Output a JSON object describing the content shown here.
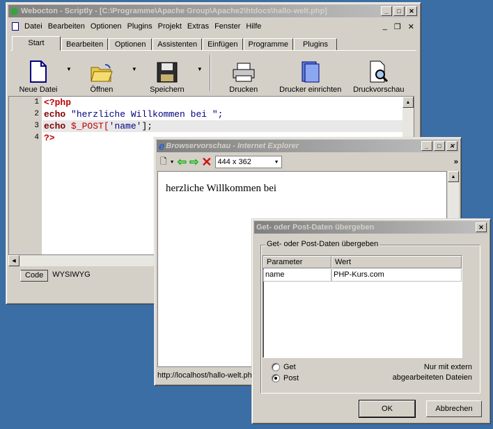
{
  "main_window": {
    "title": "Webocton - Scriptly - [C:\\Programme\\Apache Group\\Apache2\\htdocs\\hallo-welt.php]",
    "menu": [
      "Datei",
      "Bearbeiten",
      "Optionen",
      "Plugins",
      "Projekt",
      "Extras",
      "Fenster",
      "Hilfe"
    ],
    "tabs": [
      "Start",
      "Bearbeiten",
      "Optionen",
      "Assistenten",
      "Einfügen",
      "Programme",
      "Plugins"
    ],
    "selected_tab": "Start",
    "toolbar": {
      "new_file": "Neue Datei",
      "open": "Öffnen",
      "save": "Speichern",
      "print": "Drucken",
      "printer_setup": "Drucker einrichten",
      "print_preview": "Druckvorschau"
    },
    "line_numbers": [
      "1",
      "2",
      "3",
      "4"
    ],
    "code": {
      "l1": "<?php",
      "l2_kw": "echo",
      "l2_str": " \"herzliche Willkommen bei \";",
      "l3_kw": "echo",
      "l3_var": " $_POST[",
      "l3_str": "'name'",
      "l3_end": "];",
      "l4": "?>"
    },
    "bottom_tabs": [
      "Code",
      "WYSIWYG"
    ]
  },
  "browser_window": {
    "title": "Browservorschau - Internet Explorer",
    "size": "444 x 362",
    "content_text": "herzliche Willkommen bei",
    "status": "http://localhost/hallo-welt.ph"
  },
  "dialog": {
    "title": "Get- oder Post-Daten übergeben",
    "group_label": "Get- oder Post-Daten übergeben",
    "columns": [
      "Parameter",
      "Wert"
    ],
    "rows": [
      {
        "param": "name",
        "value": "PHP-Kurs.com"
      }
    ],
    "radio_get": "Get",
    "radio_post": "Post",
    "selected_method": "Post",
    "note_line1": "Nur mit extern",
    "note_line2": "abgearbeiteten Dateien",
    "ok": "OK",
    "cancel": "Abbrechen"
  }
}
